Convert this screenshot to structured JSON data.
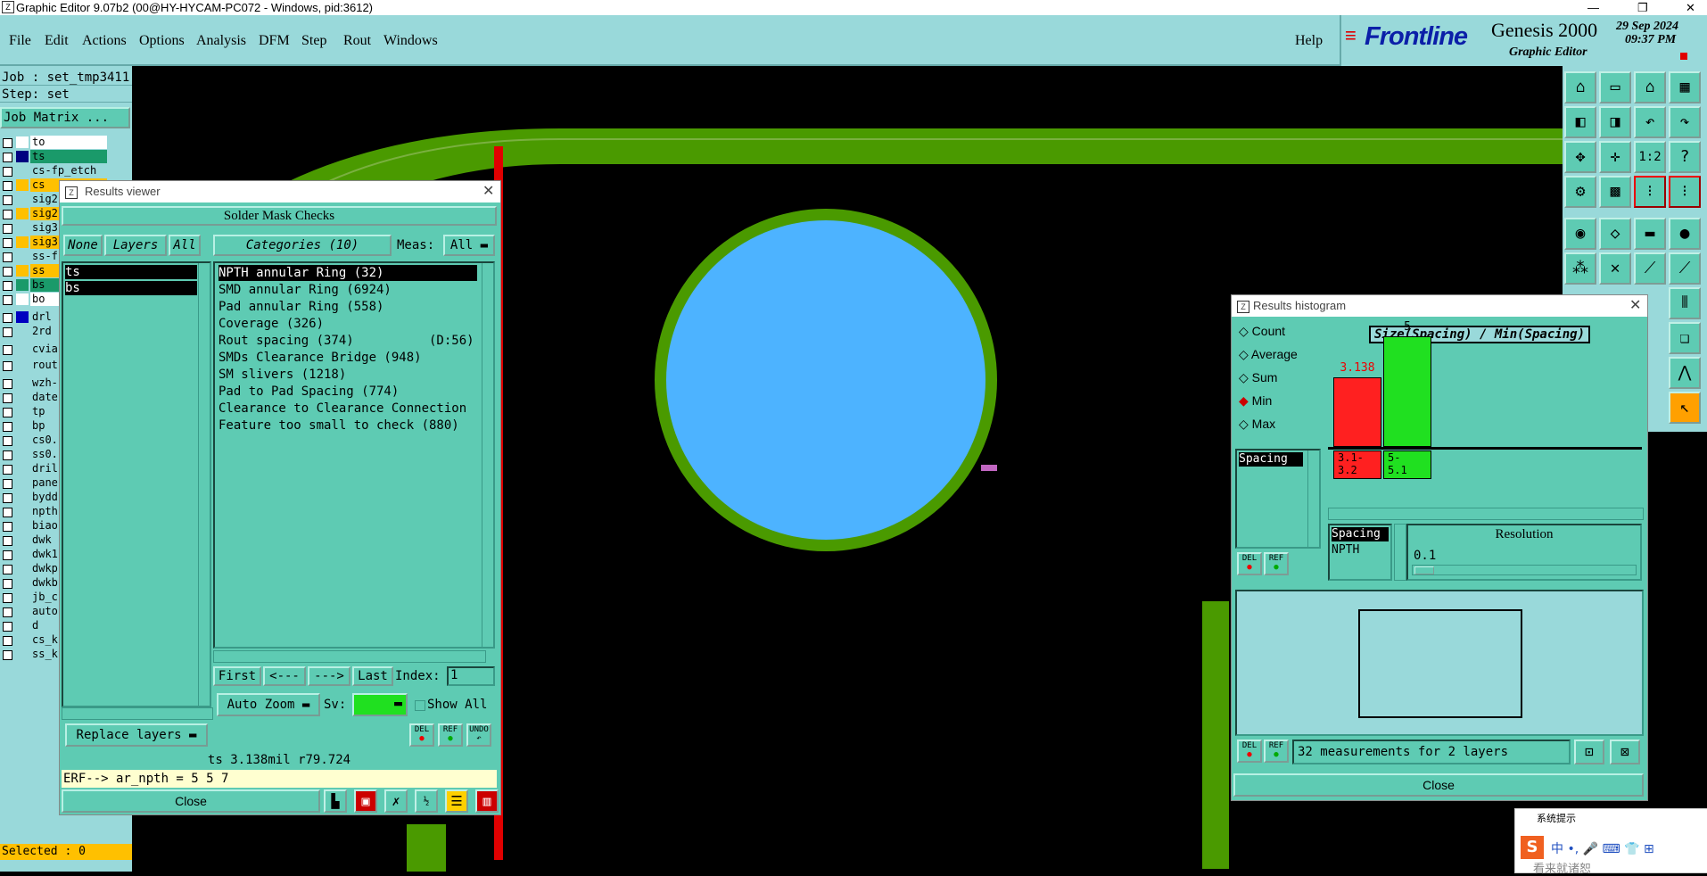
{
  "window": {
    "title": "Graphic Editor 9.07b2 (00@HY-HYCAM-PC072 - Windows, pid:3612)",
    "controls": [
      "—",
      "❐",
      "✕"
    ]
  },
  "menubar": {
    "items": [
      "File",
      "Edit",
      "Actions",
      "Options",
      "Analysis",
      "DFM",
      "Step",
      "Rout",
      "Windows"
    ],
    "help": "Help"
  },
  "branding": {
    "logo": "Frontline",
    "product": "Genesis 2000",
    "subtitle": "Graphic Editor",
    "date": "29 Sep 2024",
    "time": "09:37 PM"
  },
  "left_panel": {
    "job": "Job : set_tmp3411",
    "step": "Step: set",
    "job_matrix": "Job Matrix ...",
    "layers": [
      {
        "name": "to",
        "color": "#ffffff",
        "swatch": "#ffffff"
      },
      {
        "name": "ts",
        "color": "#1a9a6a",
        "swatch": "#000080"
      },
      {
        "name": "cs-fp_etch",
        "color": "#99d9da",
        "swatch": "#99d9da"
      },
      {
        "name": "cs",
        "color": "#ffc000",
        "swatch": "#ffc000"
      },
      {
        "name": "sig2",
        "color": "#99d9da",
        "swatch": "#99d9da"
      },
      {
        "name": "sig2",
        "color": "#ffc000",
        "swatch": "#ffc000"
      },
      {
        "name": "sig3",
        "color": "#99d9da",
        "swatch": "#99d9da"
      },
      {
        "name": "sig3",
        "color": "#ffc000",
        "swatch": "#ffc000"
      },
      {
        "name": "ss-f",
        "color": "#99d9da",
        "swatch": "#99d9da"
      },
      {
        "name": "ss",
        "color": "#ffc000",
        "swatch": "#ffc000"
      },
      {
        "name": "bs",
        "color": "#1a9a6a",
        "swatch": "#1a9a6a"
      },
      {
        "name": "bo",
        "color": "#ffffff",
        "swatch": "#ffffff"
      },
      {
        "name": "drl",
        "color": "#99d9da",
        "swatch": "#0000c0"
      },
      {
        "name": "2rd",
        "color": "#99d9da",
        "swatch": "#99d9da"
      },
      {
        "name": "cvia",
        "color": "#99d9da",
        "swatch": "#99d9da"
      },
      {
        "name": "rout",
        "color": "#99d9da",
        "swatch": "#99d9da"
      },
      {
        "name": "wzh-",
        "color": "#99d9da",
        "swatch": "#99d9da"
      },
      {
        "name": "date",
        "color": "#99d9da",
        "swatch": "#99d9da"
      },
      {
        "name": "tp",
        "color": "#99d9da",
        "swatch": "#99d9da"
      },
      {
        "name": "bp",
        "color": "#99d9da",
        "swatch": "#99d9da"
      },
      {
        "name": "cs0.",
        "color": "#99d9da",
        "swatch": "#99d9da"
      },
      {
        "name": "ss0.",
        "color": "#99d9da",
        "swatch": "#99d9da"
      },
      {
        "name": "dril",
        "color": "#99d9da",
        "swatch": "#99d9da"
      },
      {
        "name": "pane",
        "color": "#99d9da",
        "swatch": "#99d9da"
      },
      {
        "name": "bydd",
        "color": "#99d9da",
        "swatch": "#99d9da"
      },
      {
        "name": "npth",
        "color": "#99d9da",
        "swatch": "#99d9da"
      },
      {
        "name": "biao",
        "color": "#99d9da",
        "swatch": "#99d9da"
      },
      {
        "name": "dwk",
        "color": "#99d9da",
        "swatch": "#99d9da"
      },
      {
        "name": "dwk1",
        "color": "#99d9da",
        "swatch": "#99d9da"
      },
      {
        "name": "dwkp",
        "color": "#99d9da",
        "swatch": "#99d9da"
      },
      {
        "name": "dwkb",
        "color": "#99d9da",
        "swatch": "#99d9da"
      },
      {
        "name": "jb_c",
        "color": "#99d9da",
        "swatch": "#99d9da"
      },
      {
        "name": "auto",
        "color": "#99d9da",
        "swatch": "#99d9da"
      },
      {
        "name": "d",
        "color": "#99d9da",
        "swatch": "#99d9da"
      },
      {
        "name": "cs_k",
        "color": "#99d9da",
        "swatch": "#99d9da"
      },
      {
        "name": "ss_k",
        "color": "#99d9da",
        "swatch": "#99d9da"
      }
    ],
    "selected": "Selected : 0"
  },
  "results_viewer": {
    "title": "Results viewer",
    "header": "Solder Mask Checks",
    "none_btn": "None",
    "layers_btn": "Layers",
    "all_btn": "All",
    "categories_btn": "Categories (10)",
    "meas_label": "Meas:",
    "meas_value": "All",
    "layers": [
      "ts",
      "bs"
    ],
    "categories": [
      "NPTH annular Ring (32)",
      "SMD annular Ring (6924)",
      "Pad annular Ring (558)",
      "Coverage (326)",
      "Rout spacing (374)          (D:56)",
      "SMDs Clearance Bridge (948)",
      "SM slivers (1218)",
      "Pad to Pad Spacing (774)",
      "Clearance to Clearance Connection",
      "Feature too small to check (880)"
    ],
    "nav": {
      "first": "First",
      "prev": "<---",
      "next": "--->",
      "last": "Last",
      "index_label": "Index:",
      "index_value": "1"
    },
    "auto_zoom": "Auto Zoom",
    "sv_label": "Sv:",
    "show_all": "Show All",
    "replace_layers": "Replace layers",
    "mini_buttons": [
      "DEL",
      "REF",
      "UNDO"
    ],
    "status": "ts 3.138mil  r79.724",
    "erf": "ERF--> ar_npth = 5 5 7",
    "close": "Close"
  },
  "histogram": {
    "title": "Results histogram",
    "modes": [
      "Count",
      "Average",
      "Sum",
      "Min",
      "Max"
    ],
    "selected_mode": "Min",
    "list_item": "Spacing",
    "chart_title": "Size(Spacing) / Min(Spacing)",
    "bars": [
      {
        "label": "3.1-\n3.2",
        "value": 3.138,
        "value_label": "3.138",
        "color": "#ff2020"
      },
      {
        "label": "5-\n5.1",
        "value": 5,
        "value_label": "5",
        "color": "#20e020"
      }
    ],
    "attr_list": [
      "Spacing",
      "NPTH"
    ],
    "resolution_label": "Resolution",
    "resolution_value": "0.1",
    "mini_buttons": [
      "DEL",
      "REF"
    ],
    "measurements": "32 measurements for 2 layers",
    "close": "Close"
  },
  "ime": {
    "title": "系统提示",
    "logo": "S",
    "chars": "中 •, 🎤 ⌨ 👕 ⊞",
    "footer": "看来就诸恕"
  }
}
